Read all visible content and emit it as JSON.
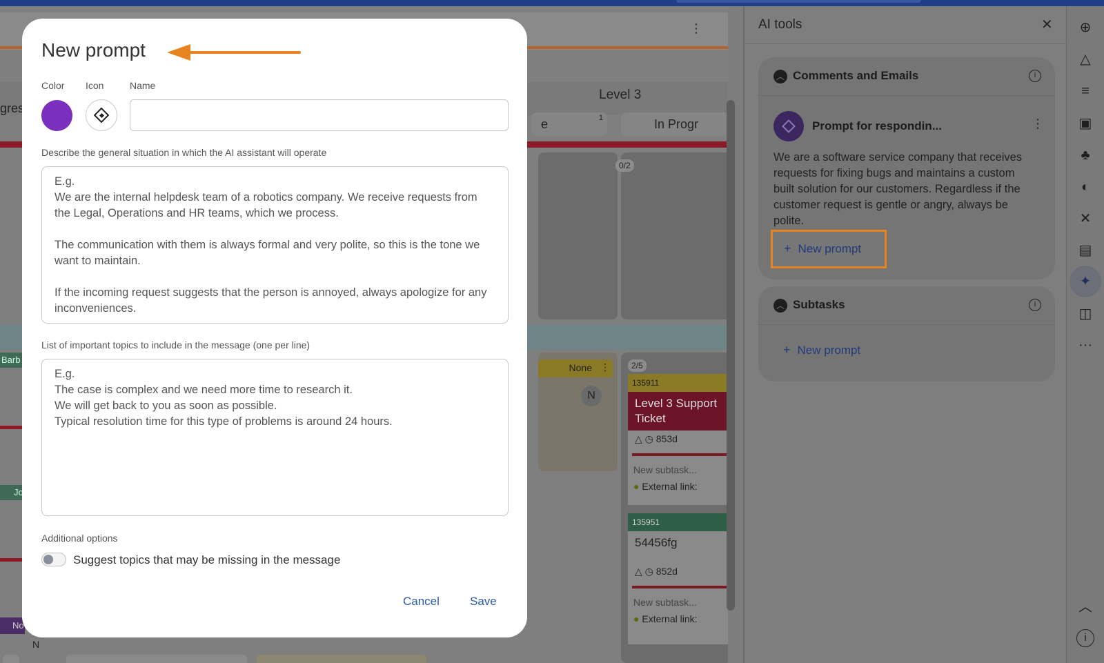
{
  "board": {
    "level_title": "Level 3",
    "col_pill_a": "e",
    "col_pill_a_count": "1",
    "col_pill_b": "In Progr",
    "left_partial": "gres",
    "frac_1": "0/2",
    "frac_2": "2/5",
    "none_label": "None",
    "n_avatar": "N",
    "left_label_1": "Barb",
    "left_label_2": "Jo",
    "left_label_3": "No",
    "bottom_n": "N",
    "card1": {
      "id": "135911",
      "title": "Level 3 Support Ticket",
      "age": "853d",
      "subtask": "New subtask...",
      "ext": "External link:"
    },
    "card2": {
      "id": "135951",
      "title": "54456fg",
      "age": "852d",
      "subtask": "New subtask...",
      "ext": "External link:"
    }
  },
  "modal": {
    "title": "New prompt",
    "color_label": "Color",
    "icon_label": "Icon",
    "name_label": "Name",
    "name_value": "",
    "situation_label": "Describe the general situation in which the AI assistant will operate",
    "situation_placeholder": "E.g.\nWe are the internal helpdesk team of a robotics company. We receive requests from the Legal, Operations and HR teams, which we process.\n\nThe communication with them is always formal and very polite, so this is the tone we want to maintain.\n\nIf the incoming request suggests that the person is annoyed, always apologize for any inconveniences.",
    "topics_label": "List of important topics to include in the message (one per line)",
    "topics_placeholder": "E.g.\nThe case is complex and we need more time to research it.\nWe will get back to you as soon as possible.\nTypical resolution time for this type of problems is around 24 hours.",
    "additional_label": "Additional options",
    "toggle_label": "Suggest topics that may be missing in the message",
    "toggle_on": false,
    "cancel_label": "Cancel",
    "save_label": "Save",
    "selected_color": "#7b2fbe"
  },
  "panel": {
    "title": "AI tools",
    "section1": {
      "title": "Comments and Emails",
      "prompt_name": "Prompt for respondin...",
      "prompt_desc": "We are a software service company that receives requests for fixing bugs and maintains a custom built solution for our customers. Regardless if the customer request is gentle or angry, always be polite.",
      "new_prompt": "New prompt"
    },
    "section2": {
      "title": "Subtasks",
      "new_prompt": "New prompt"
    }
  },
  "rail": {
    "icons": [
      "plus-circle-icon",
      "shapes-icon",
      "filter-icon",
      "briefcase-clock-icon",
      "hierarchy-icon",
      "palette-icon",
      "tools-icon",
      "document-icon",
      "ai-sparkle-icon",
      "chat-icon",
      "more-icon",
      "chevron-up-icon",
      "info-icon"
    ],
    "more_glyph": "···"
  },
  "accent_colors": {
    "highlight_orange": "#e6841f",
    "link_blue": "#2b5aa6",
    "topbar": "#1f3e87"
  }
}
